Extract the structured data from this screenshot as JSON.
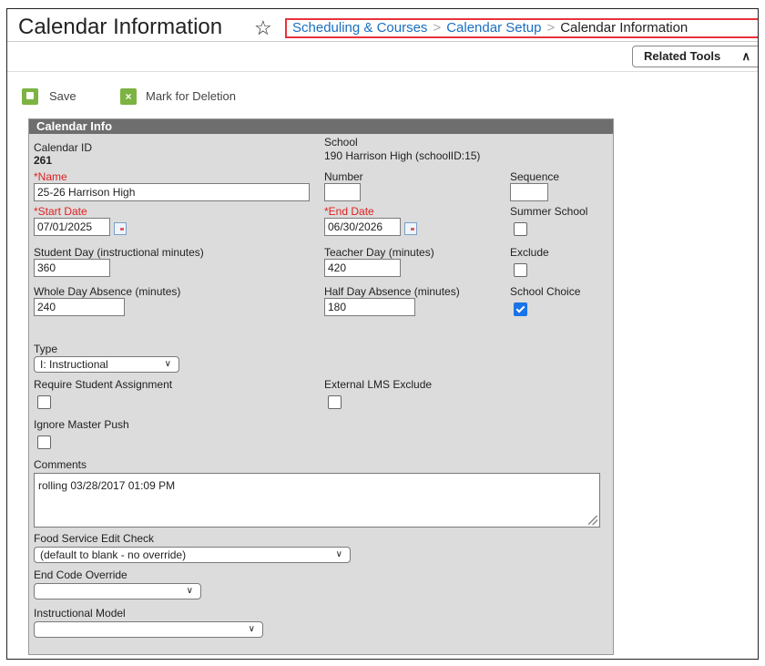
{
  "header": {
    "title": "Calendar Information",
    "breadcrumb": [
      {
        "label": "Scheduling & Courses",
        "link": true
      },
      {
        "label": "Calendar Setup",
        "link": true
      },
      {
        "label": "Calendar Information",
        "link": false
      }
    ],
    "related_tools": "Related Tools"
  },
  "toolbar": {
    "save_label": "Save",
    "delete_label": "Mark for Deletion"
  },
  "panel": {
    "title": "Calendar Info",
    "calendar_id_label": "Calendar ID",
    "calendar_id_value": "261",
    "school_label": "School",
    "school_value": "190 Harrison High (schoolID:15)",
    "name_label": "*Name",
    "name_value": "25-26 Harrison High",
    "number_label": "Number",
    "number_value": "",
    "sequence_label": "Sequence",
    "sequence_value": "",
    "start_date_label": "*Start Date",
    "start_date_value": "07/01/2025",
    "end_date_label": "*End Date",
    "end_date_value": "06/30/2026",
    "summer_school_label": "Summer School",
    "summer_school_checked": false,
    "student_day_label": "Student Day (instructional minutes)",
    "student_day_value": "360",
    "teacher_day_label": "Teacher Day (minutes)",
    "teacher_day_value": "420",
    "exclude_label": "Exclude",
    "exclude_checked": false,
    "whole_day_label": "Whole Day Absence (minutes)",
    "whole_day_value": "240",
    "half_day_label": "Half Day Absence (minutes)",
    "half_day_value": "180",
    "school_choice_label": "School Choice",
    "school_choice_checked": true,
    "type_label": "Type",
    "type_value": "I: Instructional",
    "require_student_label": "Require Student Assignment",
    "require_student_checked": false,
    "external_lms_label": "External LMS Exclude",
    "external_lms_checked": false,
    "ignore_master_label": "Ignore Master Push",
    "ignore_master_checked": false,
    "comments_label": "Comments",
    "comments_value": "rolling 03/28/2017 01:09 PM",
    "food_service_label": "Food Service Edit Check",
    "food_service_value": "(default to blank - no override)",
    "end_code_label": "End Code Override",
    "end_code_value": "",
    "instructional_model_label": "Instructional Model",
    "instructional_model_value": ""
  },
  "icons": {
    "star": "star-icon",
    "save": "save-icon",
    "delete": "delete-icon",
    "calendar": "calendar-icon",
    "chevron_up": "chevron-up-icon",
    "chevron_down": "chevron-down-icon"
  },
  "colors": {
    "accent_link": "#1a6fbf",
    "required": "#e02020",
    "highlight_border": "#e8333b",
    "toolbar_icon": "#7cb342",
    "panel_header": "#6e6e6e",
    "panel_bg": "#dcdcdc",
    "checkbox_checked": "#1a73e8"
  }
}
